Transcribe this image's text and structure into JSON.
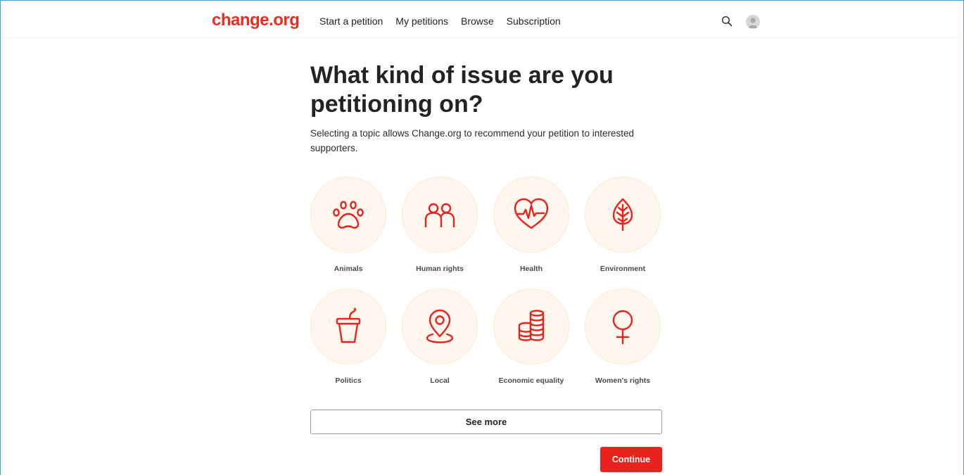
{
  "brand": {
    "logo": "change.org",
    "accent": "#ec2c22"
  },
  "nav": {
    "items": [
      "Start a petition",
      "My petitions",
      "Browse",
      "Subscription"
    ]
  },
  "header_icons": [
    "search-icon",
    "user-avatar-icon"
  ],
  "main": {
    "title": "What kind of issue are you petitioning on?",
    "subtitle": "Selecting a topic allows Change.org to recommend your petition to interested supporters.",
    "topics": [
      {
        "label": "Animals",
        "icon": "paw-icon"
      },
      {
        "label": "Human rights",
        "icon": "people-icon"
      },
      {
        "label": "Health",
        "icon": "heart-pulse-icon"
      },
      {
        "label": "Environment",
        "icon": "leaf-icon"
      },
      {
        "label": "Politics",
        "icon": "cup-icon"
      },
      {
        "label": "Local",
        "icon": "location-pin-icon"
      },
      {
        "label": "Economic equality",
        "icon": "coins-icon"
      },
      {
        "label": "Women's rights",
        "icon": "female-symbol-icon"
      }
    ],
    "see_more": "See more",
    "continue": "Continue"
  }
}
